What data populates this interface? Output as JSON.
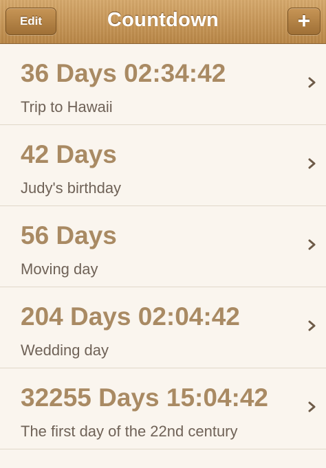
{
  "navbar": {
    "title": "Countdown",
    "edit_label": "Edit",
    "add_label": "+"
  },
  "countdowns": [
    {
      "count": "36 Days 02:34:42",
      "label": "Trip to Hawaii"
    },
    {
      "count": "42 Days",
      "label": "Judy's birthday"
    },
    {
      "count": "56 Days",
      "label": "Moving day"
    },
    {
      "count": "204 Days 02:04:42",
      "label": "Wedding day"
    },
    {
      "count": "32255 Days 15:04:42",
      "label": "The first day of the 22nd century"
    }
  ],
  "colors": {
    "navbar": "#c4935a",
    "count_text": "#a98a63",
    "label_text": "#6f6257",
    "background": "#f9f4ec"
  }
}
